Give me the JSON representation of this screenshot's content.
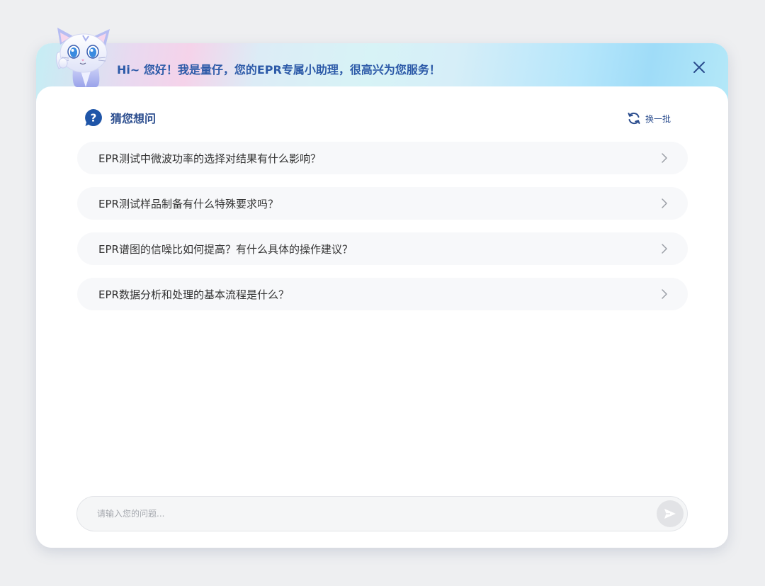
{
  "header": {
    "greeting": "Hi~  您好！我是量仔，您的EPR专属小助理，很高兴为您服务！"
  },
  "suggestions": {
    "title": "猜您想问",
    "refresh_label": "换一批",
    "items": [
      {
        "text": "EPR测试中微波功率的选择对结果有什么影响？"
      },
      {
        "text": "EPR测试样品制备有什么特殊要求吗？"
      },
      {
        "text": "EPR谱图的信噪比如何提高？有什么具体的操作建议？"
      },
      {
        "text": "EPR数据分析和处理的基本流程是什么？"
      }
    ]
  },
  "input": {
    "placeholder": "请输入您的问题...",
    "value": ""
  },
  "icons": {
    "mascot": "cat-mascot-icon",
    "close": "close-icon",
    "question": "question-bubble-icon",
    "refresh": "refresh-icon",
    "chevron": "chevron-right-icon",
    "send": "send-icon"
  },
  "colors": {
    "accent": "#2b4d8e",
    "greeting": "#2c5aa8",
    "question_icon": "#1f55a8"
  }
}
